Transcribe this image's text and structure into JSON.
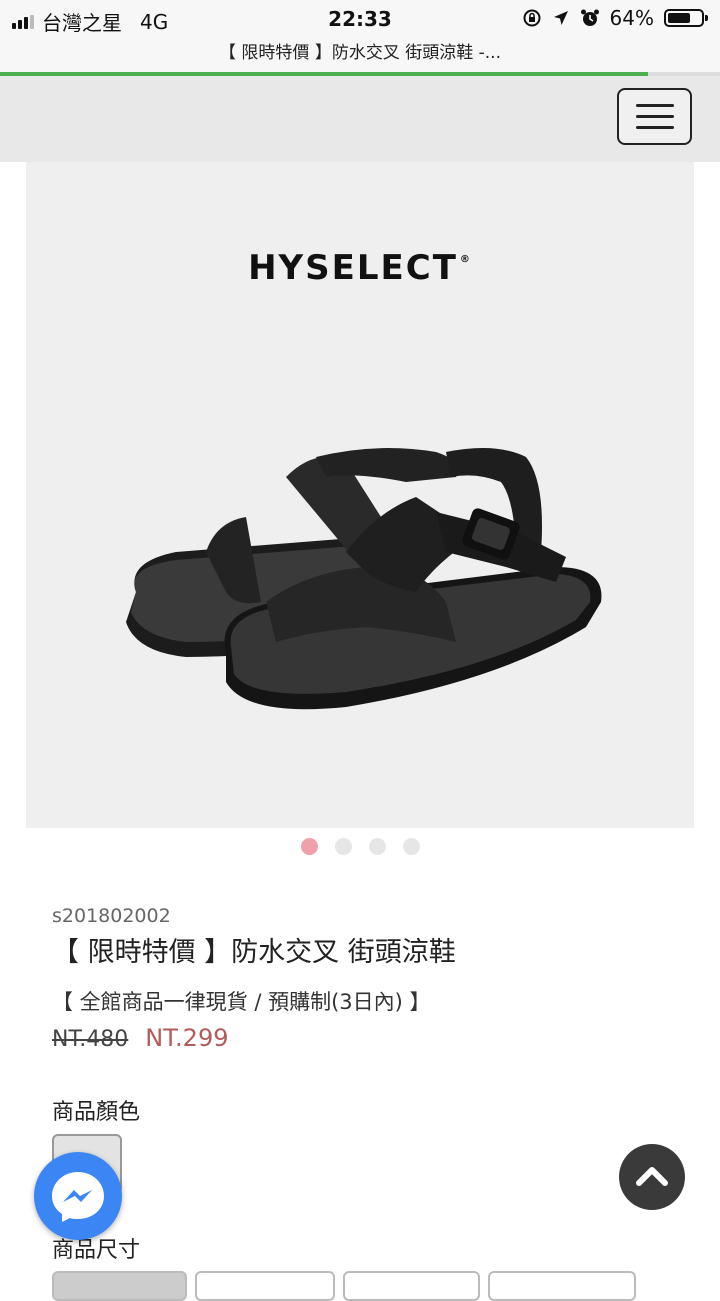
{
  "status_bar": {
    "carrier": "台灣之星",
    "network": "4G",
    "time": "22:33",
    "battery": "64%"
  },
  "browser": {
    "page_title": "【 限時特價 】防水交叉 街頭涼鞋 -..."
  },
  "hero": {
    "brand": "HYSELECT",
    "brand_mark": "®",
    "slide_count": 4,
    "active_slide": 1
  },
  "product": {
    "sku": "s201802002",
    "title": "【 限時特價 】防水交叉 街頭涼鞋",
    "subtitle": "【 全館商品一律現貨 / 預購制(3日內) 】",
    "original_price": "NT.480",
    "sale_price": "NT.299",
    "color_label": "商品顏色",
    "size_label": "商品尺寸"
  },
  "colors": {
    "progress": "#4caf50",
    "sale_price": "#b35a5a",
    "messenger": "#3b86f4",
    "dot_active": "#f0a0aa"
  },
  "icons": {
    "menu": "hamburger-icon",
    "messenger": "messenger-icon",
    "back_to_top": "chevron-up-icon"
  }
}
